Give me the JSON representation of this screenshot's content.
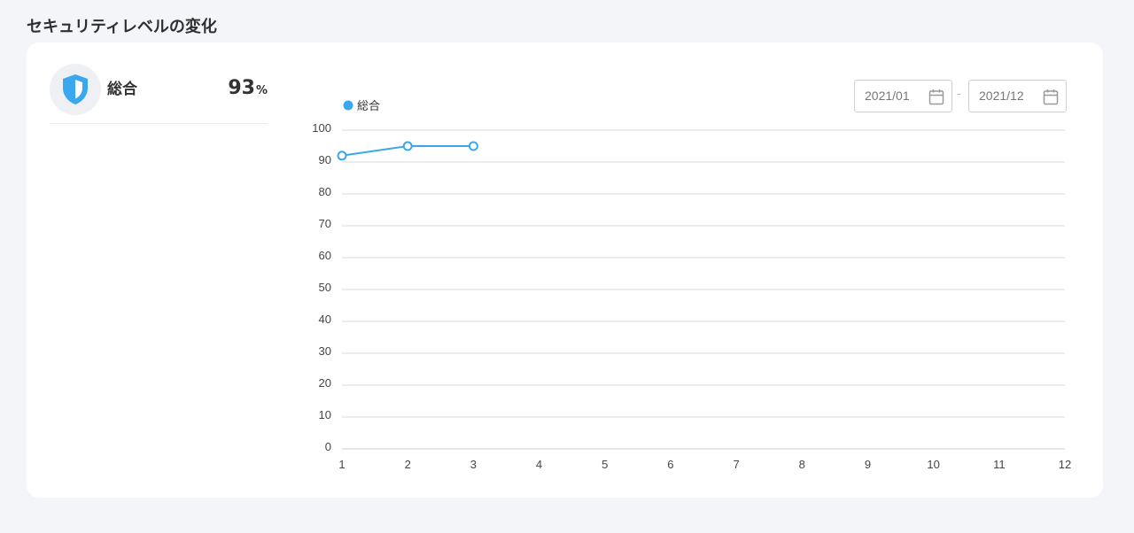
{
  "page": {
    "title": "セキュリティレベルの変化"
  },
  "summary": {
    "label": "総合",
    "value": "93",
    "unit": "%"
  },
  "date_range": {
    "from": "2021/01",
    "separator": "-",
    "to": "2021/12"
  },
  "colors": {
    "accent": "#3aa8ee",
    "shield": "#3aa8ee",
    "grid": "#d9d9d9"
  },
  "icons": {
    "summary": "shield-icon",
    "date": "calendar-icon"
  },
  "chart_data": {
    "type": "line",
    "title": "",
    "xlabel": "",
    "ylabel": "",
    "categories": [
      "1",
      "2",
      "3",
      "4",
      "5",
      "6",
      "7",
      "8",
      "9",
      "10",
      "11",
      "12"
    ],
    "series": [
      {
        "name": "総合",
        "x": [
          1,
          2,
          3
        ],
        "values": [
          92,
          95,
          95
        ]
      }
    ],
    "ylim": [
      0,
      100
    ],
    "yticks": [
      0,
      10,
      20,
      30,
      40,
      50,
      60,
      70,
      80,
      90,
      100
    ],
    "xlim": [
      1,
      12
    ],
    "grid": true,
    "legend": "top-left"
  }
}
